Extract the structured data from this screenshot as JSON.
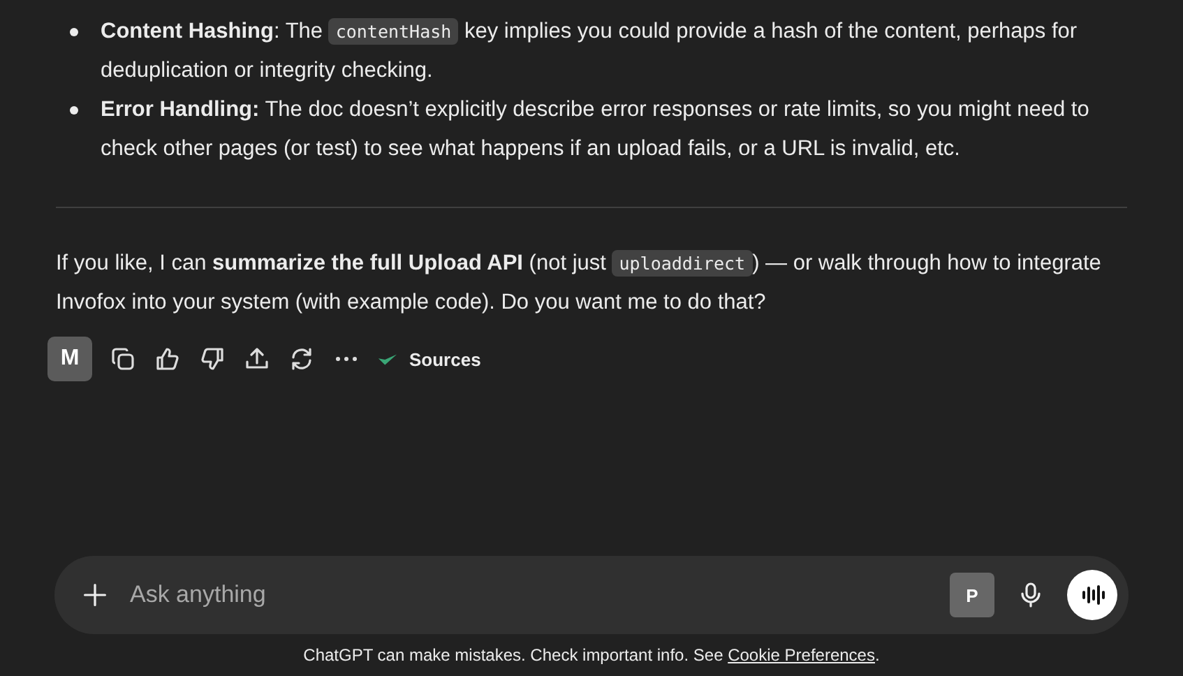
{
  "message": {
    "bullets": [
      {
        "parts": [
          {
            "kind": "text",
            "text": "**Content Hashing**: The "
          },
          {
            "kind": "code",
            "text": "contentHash"
          },
          {
            "kind": "text",
            "text": " key implies you could provide a hash of the content, perhaps for deduplication or integrity checking."
          }
        ]
      },
      {
        "parts": [
          {
            "kind": "text",
            "text": "**Error Handling:** The doc doesn’t explicitly describe error responses or rate limits, so you might need to check other pages (or test) to see what happens if an upload fails, or a URL is invalid, etc."
          }
        ]
      }
    ],
    "closing": [
      {
        "kind": "text",
        "text": "If you like, I can **summarize the full Upload API** (not just "
      },
      {
        "kind": "code",
        "text": "uploaddirect"
      },
      {
        "kind": "text",
        "text": ") — or walk through how to integrate Invofox into your system (with example code). Do you want me to do that?"
      }
    ]
  },
  "actions": {
    "avatar": "M",
    "sources": "Sources"
  },
  "composer": {
    "placeholder": "Ask anything",
    "badge": "P"
  },
  "footer": {
    "text": "ChatGPT can make mistakes. Check important info. See ",
    "link": "Cookie Preferences",
    "end": "."
  }
}
